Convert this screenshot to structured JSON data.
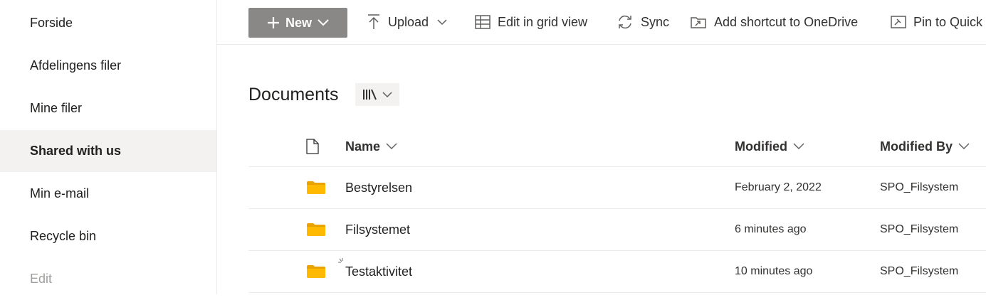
{
  "sidebar": {
    "items": [
      {
        "label": "Forside"
      },
      {
        "label": "Afdelingens filer"
      },
      {
        "label": "Mine filer"
      },
      {
        "label": "Shared with us"
      },
      {
        "label": "Min e-mail"
      },
      {
        "label": "Recycle bin"
      },
      {
        "label": "Edit"
      }
    ],
    "selected": "Shared with us"
  },
  "toolbar": {
    "new_label": "New",
    "upload_label": "Upload",
    "edit_grid_label": "Edit in grid view",
    "sync_label": "Sync",
    "shortcut_label": "Add shortcut to OneDrive",
    "pin_label": "Pin to Quick"
  },
  "library": {
    "title": "Documents"
  },
  "columns": {
    "name": "Name",
    "modified": "Modified",
    "modified_by": "Modified By"
  },
  "rows": [
    {
      "name": "Bestyrelsen",
      "modified": "February 2, 2022",
      "modified_by": "SPO_Filsystem",
      "icon": "folder-icon"
    },
    {
      "name": "Filsystemet",
      "modified": "6 minutes ago",
      "modified_by": "SPO_Filsystem",
      "icon": "folder-icon"
    },
    {
      "name": "Testaktivitet",
      "modified": "10 minutes ago",
      "modified_by": "SPO_Filsystem",
      "icon": "folder-icon"
    }
  ],
  "colors": {
    "new_button_bg": "#8a8886",
    "selected_nav_bg": "#f3f2f1",
    "folder": "#ffb900"
  }
}
